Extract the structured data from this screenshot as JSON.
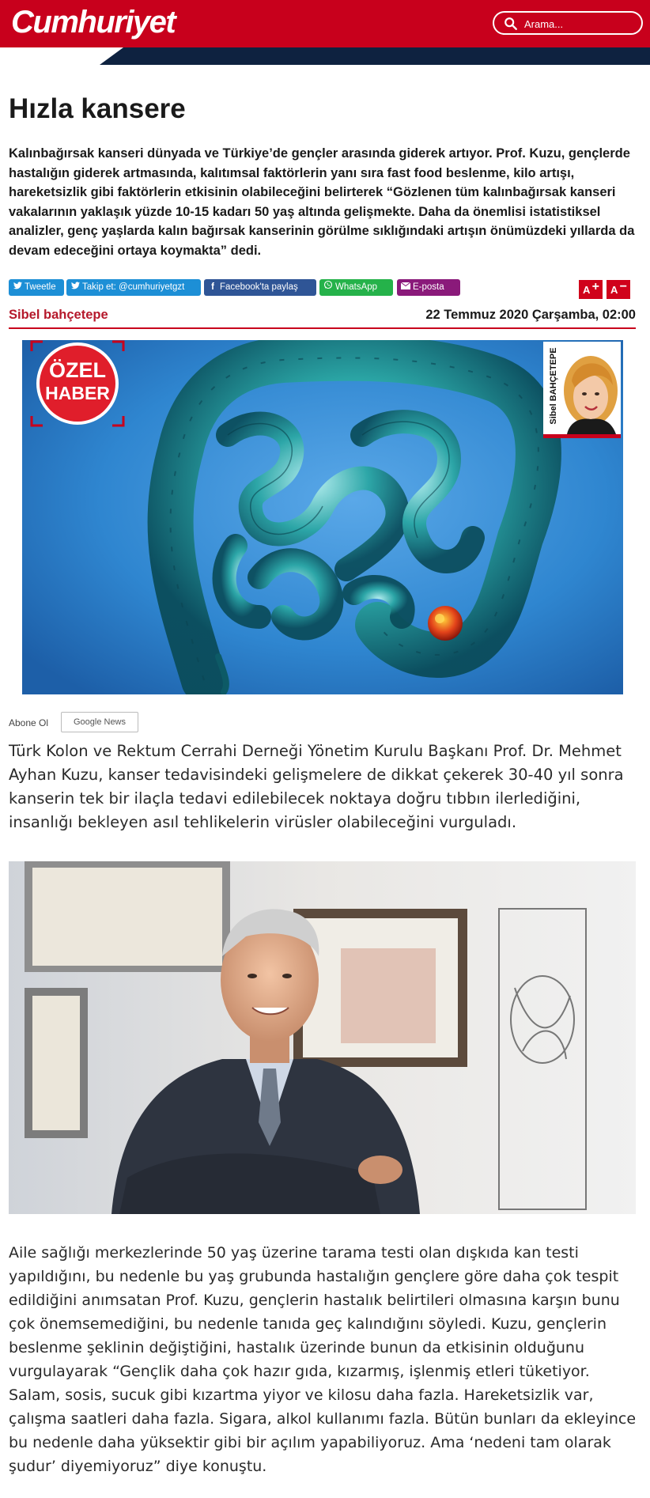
{
  "header": {
    "logo": "Cumhuriyet",
    "search_placeholder": "Arama..."
  },
  "article": {
    "title": "Hızla kansere",
    "summary": "Kalınbağırsak kanseri dünyada ve Türkiye’de gençler arasında giderek artıyor. Prof. Kuzu, gençlerde hastalığın giderek artmasında, kalıtımsal faktörlerin yanı sıra fast food beslenme, kilo artışı, hareketsizlik gibi faktörlerin etkisinin olabileceğini belirterek “Gözlenen tüm kalınbağırsak kanseri vakalarının yaklaşık yüzde 10-15 kadarı 50 yaş altında gelişmekte. Daha da önemlisi istatistiksel analizler, genç yaşlarda kalın bağırsak kanserinin görülme sıklığındaki artışın önümüzdeki yıllarda da devam edeceğini ortaya koymakta” dedi.",
    "author": "Sibel bahçetepe",
    "date": "22 Temmuz 2020 Çarşamba, 02:00",
    "paragraph1": "Türk Kolon ve Rektum Cerrahi Derneği Yönetim Kurulu Başkanı Prof. Dr. Mehmet Ayhan Kuzu, kanser tedavisindeki gelişmelere de dikkat çekerek 30-40 yıl sonra kanserin tek bir ilaçla tedavi edilebilecek noktaya doğru tıbbın ilerlediğini, insanlığı bekleyen asıl tehlikelerin virüsler olabileceğini vurguladı.",
    "paragraph2": "Aile sağlığı merkezlerinde 50 yaş üzerine tarama testi olan dışkıda kan testi yapıldığını, bu nedenle bu yaş grubunda hastalığın gençlere göre daha çok tespit edildiğini anımsatan Prof. Kuzu, gençlerin hastalık belirtileri olmasına karşın bunu çok önemsemediğini, bu nedenle tanıda geç kalındığını söyledi. Kuzu, gençlerin beslenme şeklinin değiştiğini, hastalık üzerinde bunun da etkisinin olduğunu vurgulayarak “Gençlik daha çok hazır gıda, kızarmış, işlenmiş etleri tüketiyor. Salam, sosis, sucuk gibi kızartma yiyor ve kilosu daha fazla. Hareketsizlik var, çalışma saatleri daha fazla. Sigara, alkol kullanımı fazla. Bütün bunları da ekleyince bu nedenle daha yüksektir gibi bir açılım yapabiliyoruz. Ama ‘nedeni tam olarak şudur’ diyemiyoruz” diye konuştu."
  },
  "share": {
    "tweet": "Tweetle",
    "follow": "Takip et: @cumhuriyetgzt",
    "facebook": "Facebook'ta paylaş",
    "whatsapp": "WhatsApp",
    "email": "E-posta"
  },
  "font_controls": {
    "increase": "A",
    "decrease": "A"
  },
  "hero": {
    "badge_line1": "ÖZEL",
    "badge_line2": "HABER",
    "portrait_name": "Sibel BAHÇETEPE"
  },
  "subscribe": {
    "label": "Abone Ol",
    "google_news": "Google News"
  },
  "colors": {
    "brand_red": "#c8001c",
    "navy": "#0e2240",
    "twitter": "#1d8fd6",
    "facebook": "#2f5596",
    "whatsapp": "#25b24a",
    "email": "#8a1a7a"
  },
  "icons": [
    "search-icon",
    "twitter-icon",
    "facebook-icon",
    "whatsapp-icon",
    "envelope-icon"
  ]
}
